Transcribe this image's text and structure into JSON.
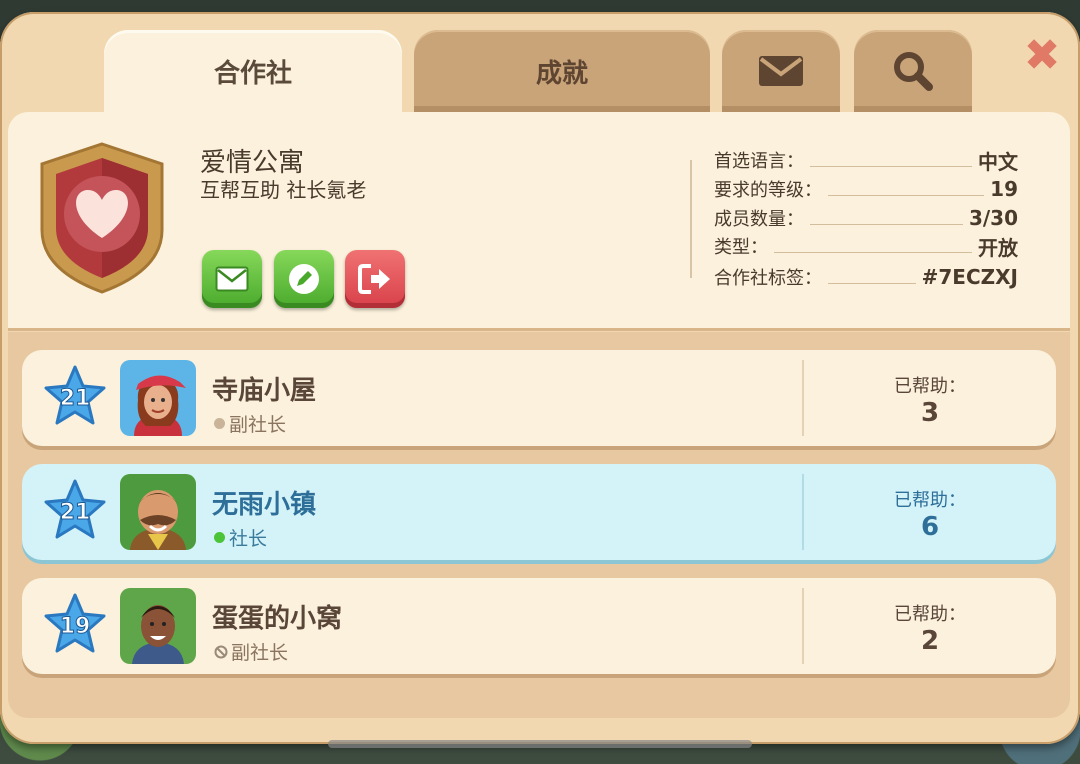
{
  "tabs": {
    "coop": "合作社",
    "achievements": "成就",
    "mail_icon": "envelope-icon",
    "search_icon": "magnifier-icon"
  },
  "close_icon": "close-icon",
  "club": {
    "name": "爱情公寓",
    "description": "互帮互助 社长氪老",
    "emblem": "heart-shield-icon",
    "actions": [
      {
        "icon": "envelope-icon",
        "color": "#49a92b"
      },
      {
        "icon": "pencil-icon",
        "color": "#49a92b"
      },
      {
        "icon": "exit-icon",
        "color": "#d8404a"
      }
    ],
    "stats": [
      {
        "label": "首选语言：",
        "value": "中文"
      },
      {
        "label": "要求的等级：",
        "value": "19"
      },
      {
        "label": "成员数量：",
        "value": "3/30"
      },
      {
        "label": "类型：",
        "value": "开放"
      },
      {
        "label": "合作社标签：",
        "value": "#7ECZXJ"
      }
    ]
  },
  "members": [
    {
      "level": "21",
      "name": "寺庙小屋",
      "role": "副社长",
      "status": "offline",
      "helped_label": "已帮助：",
      "helped": "3",
      "highlight": false
    },
    {
      "level": "21",
      "name": "无雨小镇",
      "role": "社长",
      "status": "online",
      "helped_label": "已帮助：",
      "helped": "6",
      "highlight": true
    },
    {
      "level": "19",
      "name": "蛋蛋的小窝",
      "role": "副社长",
      "status": "blocked",
      "helped_label": "已帮助：",
      "helped": "2",
      "highlight": false
    }
  ],
  "colors": {
    "panel": "#f1d8b0",
    "highlight_row": "#d4f3f8",
    "level_star": "#4aa7e8",
    "online": "#4cc43a"
  }
}
